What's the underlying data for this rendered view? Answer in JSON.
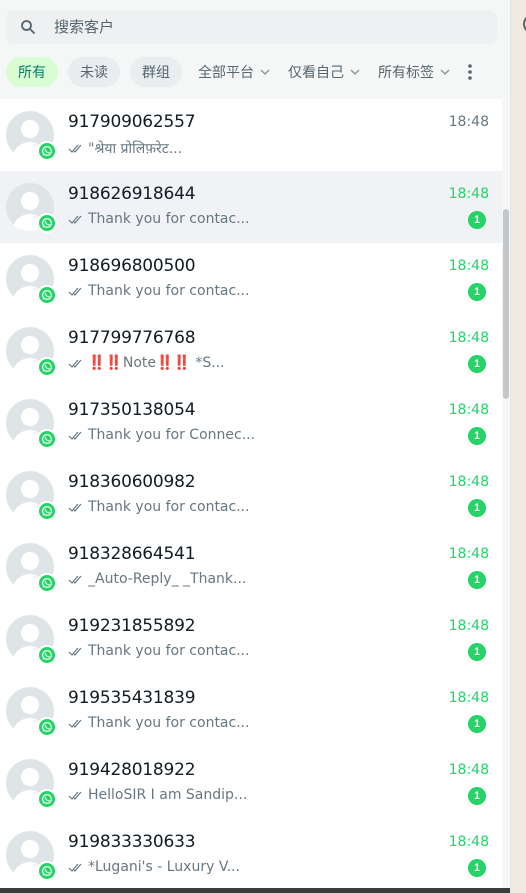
{
  "search": {
    "placeholder": "搜索客户"
  },
  "filters": {
    "chips": [
      {
        "label": "所有",
        "active": true
      },
      {
        "label": "未读",
        "active": false
      },
      {
        "label": "群组",
        "active": false
      }
    ],
    "dropdowns": [
      {
        "label": "全部平台"
      },
      {
        "label": "仅看自己"
      },
      {
        "label": "所有标签"
      }
    ]
  },
  "conversations": [
    {
      "name": "917909062557",
      "time": "18:48",
      "preview": "\"श्रेया प्रोलिफ़रेट...",
      "unread": "",
      "read": true,
      "selected": false
    },
    {
      "name": "918626918644",
      "time": "18:48",
      "preview": "Thank you for contac...",
      "unread": "1",
      "read": false,
      "selected": true
    },
    {
      "name": "918696800500",
      "time": "18:48",
      "preview": "Thank you for contac...",
      "unread": "1",
      "read": false,
      "selected": false
    },
    {
      "name": "917799776768",
      "time": "18:48",
      "preview": "‼️‼️Note‼️‼️ *S...",
      "unread": "1",
      "read": false,
      "selected": false
    },
    {
      "name": "917350138054",
      "time": "18:48",
      "preview": "Thank you for Connec...",
      "unread": "1",
      "read": false,
      "selected": false
    },
    {
      "name": "918360600982",
      "time": "18:48",
      "preview": "Thank you for contac...",
      "unread": "1",
      "read": false,
      "selected": false
    },
    {
      "name": "918328664541",
      "time": "18:48",
      "preview": "_Auto-Reply_ _Thank...",
      "unread": "1",
      "read": false,
      "selected": false
    },
    {
      "name": "919231855892",
      "time": "18:48",
      "preview": "Thank you for contac...",
      "unread": "1",
      "read": false,
      "selected": false
    },
    {
      "name": "919535431839",
      "time": "18:48",
      "preview": "Thank you for contac...",
      "unread": "1",
      "read": false,
      "selected": false
    },
    {
      "name": "919428018922",
      "time": "18:48",
      "preview": "HelloSIR I am Sandip...",
      "unread": "1",
      "read": false,
      "selected": false
    },
    {
      "name": "919833330633",
      "time": "18:48",
      "preview": "*Lugani's - Luxury V...",
      "unread": "1",
      "read": false,
      "selected": false
    }
  ],
  "colors": {
    "accent": "#25d366",
    "selected_row": "#f0f2f5",
    "active_chip": "#d9fdd3"
  }
}
